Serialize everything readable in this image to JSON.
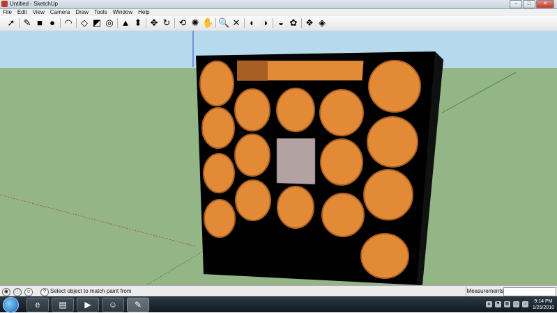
{
  "window": {
    "title": "Untitled - SketchUp"
  },
  "menu": [
    "File",
    "Edit",
    "View",
    "Camera",
    "Draw",
    "Tools",
    "Window",
    "Help"
  ],
  "toolbar": {
    "tools": [
      {
        "name": "select-tool-icon",
        "glyph": "➚"
      },
      {
        "name": "line-tool-icon",
        "glyph": "✎"
      },
      {
        "name": "rectangle-tool-icon",
        "glyph": "■"
      },
      {
        "name": "circle-tool-icon",
        "glyph": "●"
      },
      {
        "name": "arc-tool-icon",
        "glyph": "◠"
      },
      {
        "name": "make-component-icon",
        "glyph": "◇"
      },
      {
        "name": "eraser-tool-icon",
        "glyph": "◩"
      },
      {
        "name": "tape-measure-icon",
        "glyph": "◎"
      },
      {
        "name": "paint-bucket-icon",
        "glyph": "▲"
      },
      {
        "name": "push-pull-icon",
        "glyph": "⬍"
      },
      {
        "name": "move-tool-icon",
        "glyph": "✥"
      },
      {
        "name": "rotate-tool-icon",
        "glyph": "↻"
      },
      {
        "name": "offset-tool-icon",
        "glyph": "⟲"
      },
      {
        "name": "orbit-tool-icon",
        "glyph": "✺"
      },
      {
        "name": "pan-tool-icon",
        "glyph": "✋"
      },
      {
        "name": "zoom-tool-icon",
        "glyph": "🔍"
      },
      {
        "name": "zoom-extents-icon",
        "glyph": "✕"
      },
      {
        "name": "previous-view-icon",
        "glyph": "◐"
      },
      {
        "name": "next-view-icon",
        "glyph": "◑"
      },
      {
        "name": "get-models-icon",
        "glyph": "◒"
      },
      {
        "name": "share-model-icon",
        "glyph": "✿"
      },
      {
        "name": "components-icon",
        "glyph": "❖"
      },
      {
        "name": "share-component-icon",
        "glyph": "◈"
      }
    ]
  },
  "status": {
    "text": "Select object to match paint from",
    "measurements_label": "Measurements",
    "measurements_value": ""
  },
  "clock": {
    "time": "9:14 PM",
    "date": "1/25/2010"
  },
  "colors": {
    "sky": "#b6d9ee",
    "ground": "#94b586",
    "box": "#000000",
    "port": "#e38a36",
    "port_shade": "#a85f24",
    "panel": "#b2a2a2"
  }
}
